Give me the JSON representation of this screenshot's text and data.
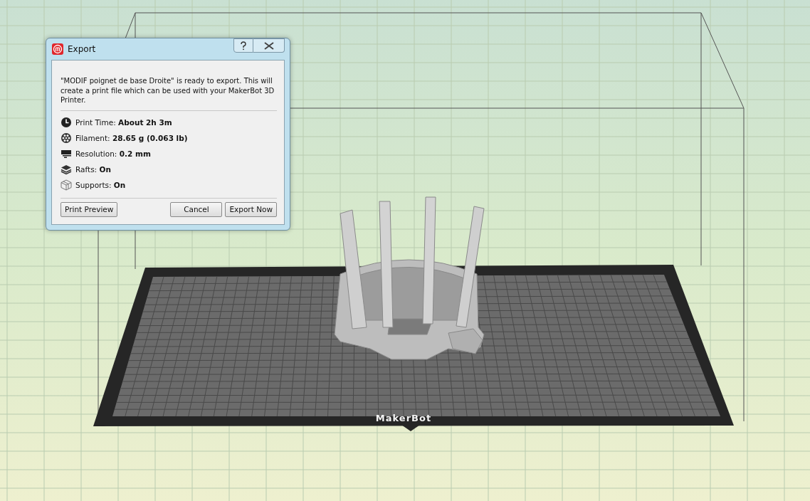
{
  "viewport": {
    "plate_label": "MakerBot"
  },
  "dialog": {
    "title": "Export",
    "message": "\"MODIF poignet de base Droite\" is ready to export. This will create a print file which can be used with your MakerBot 3D Printer.",
    "stats": [
      {
        "kind": "time",
        "label": "Print Time:",
        "value": "About 2h 3m"
      },
      {
        "kind": "filament",
        "label": "Filament:",
        "value": "28.65 g (0.063 lb)"
      },
      {
        "kind": "resolution",
        "label": "Resolution:",
        "value": "0.2 mm"
      },
      {
        "kind": "rafts",
        "label": "Rafts:",
        "value": "On"
      },
      {
        "kind": "supports",
        "label": "Supports:",
        "value": "On"
      }
    ],
    "left_button": "Print Preview",
    "buttons": [
      "Cancel",
      "Export Now"
    ]
  }
}
